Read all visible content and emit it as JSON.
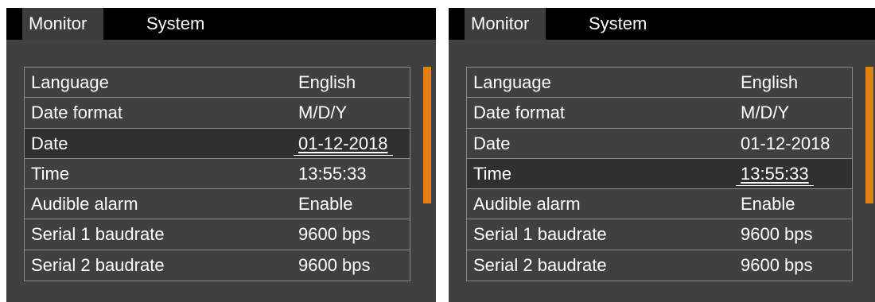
{
  "accent_color": "#e0820f",
  "panels": [
    {
      "tabs": [
        {
          "label": "Monitor",
          "active": true
        },
        {
          "label": "System",
          "active": false
        }
      ],
      "rows": [
        {
          "label": "Language",
          "value": "English"
        },
        {
          "label": "Date format",
          "value": "M/D/Y"
        },
        {
          "label": "Date",
          "value": "01-12-2018",
          "selected": true
        },
        {
          "label": "Time",
          "value": "13:55:33"
        },
        {
          "label": "Audible alarm",
          "value": "Enable"
        },
        {
          "label": "Serial 1 baudrate",
          "value": "9600 bps"
        },
        {
          "label": "Serial 2 baudrate",
          "value": "9600 bps"
        }
      ]
    },
    {
      "tabs": [
        {
          "label": "Monitor",
          "active": true
        },
        {
          "label": "System",
          "active": false
        }
      ],
      "rows": [
        {
          "label": "Language",
          "value": "English"
        },
        {
          "label": "Date format",
          "value": "M/D/Y"
        },
        {
          "label": "Date",
          "value": "01-12-2018"
        },
        {
          "label": "Time",
          "value": "13:55:33",
          "selected": true
        },
        {
          "label": "Audible alarm",
          "value": "Enable"
        },
        {
          "label": "Serial 1 baudrate",
          "value": "9600 bps"
        },
        {
          "label": "Serial 2 baudrate",
          "value": "9600 bps"
        }
      ]
    }
  ]
}
